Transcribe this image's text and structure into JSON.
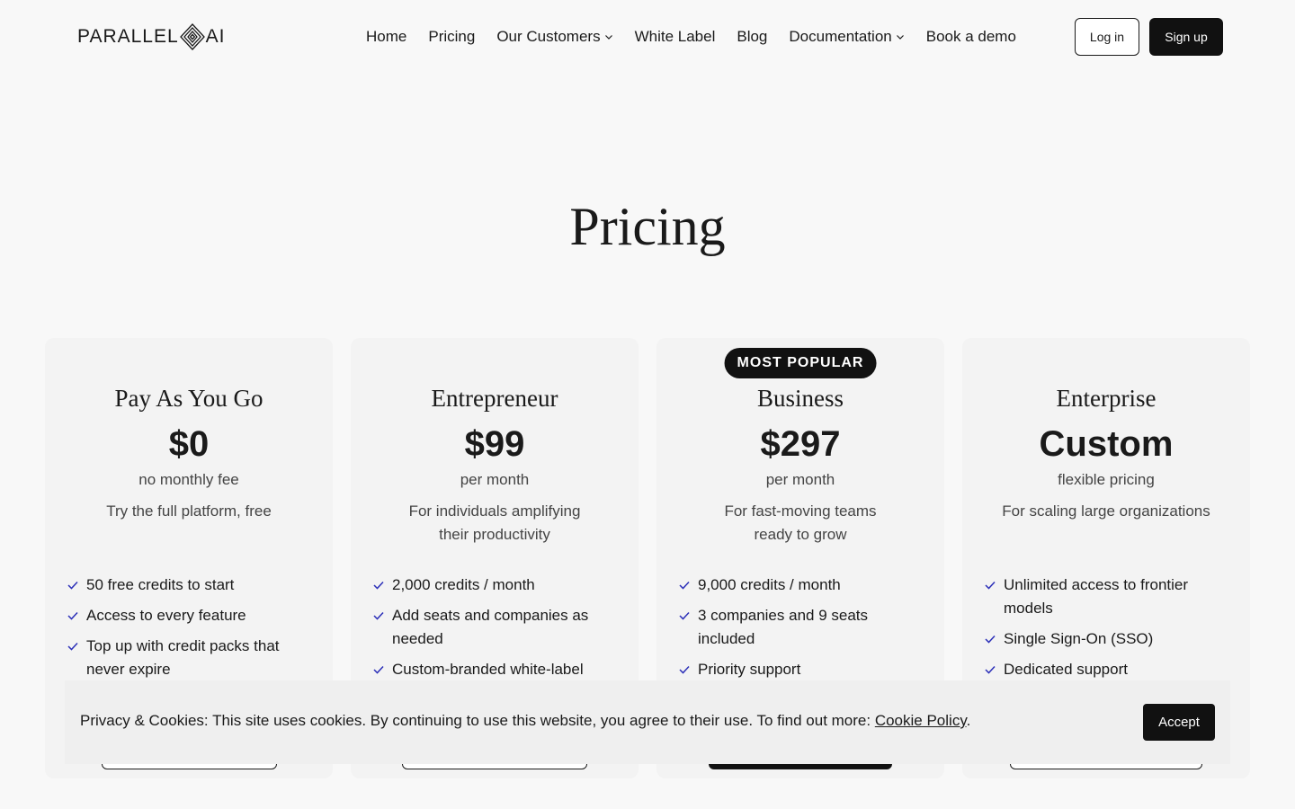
{
  "header": {
    "logo_left": "PARALLEL",
    "logo_right": "AI",
    "nav": [
      {
        "label": "Home",
        "has_dropdown": false
      },
      {
        "label": "Pricing",
        "has_dropdown": false
      },
      {
        "label": "Our Customers",
        "has_dropdown": true
      },
      {
        "label": "White Label",
        "has_dropdown": false
      },
      {
        "label": "Blog",
        "has_dropdown": false
      },
      {
        "label": "Documentation",
        "has_dropdown": true
      },
      {
        "label": "Book a demo",
        "has_dropdown": false
      }
    ],
    "login_label": "Log in",
    "signup_label": "Sign up"
  },
  "title": "Pricing",
  "plans": [
    {
      "name": "Pay As You Go",
      "price": "$0",
      "period": "no monthly fee",
      "description": "Try the full platform, free",
      "features": [
        "50 free credits to start",
        "Access to every feature",
        "Top up with credit packs that never expire"
      ]
    },
    {
      "name": "Entrepreneur",
      "price": "$99",
      "period": "per month",
      "description": "For individuals amplifying their productivity",
      "features": [
        "2,000 credits / month",
        "Add seats and companies as needed",
        "Custom-branded white-label"
      ]
    },
    {
      "name": "Business",
      "badge": "MOST POPULAR",
      "price": "$297",
      "period": "per month",
      "description": "For fast-moving teams ready to grow",
      "features": [
        "9,000 credits / month",
        "3 companies and 9 seats included",
        "Priority support"
      ]
    },
    {
      "name": "Enterprise",
      "price": "Custom",
      "period": "flexible pricing",
      "description": "For scaling large organizations",
      "features": [
        "Unlimited access to frontier models",
        "Single Sign-On (SSO)",
        "Dedicated support"
      ]
    }
  ],
  "cookie": {
    "text": "Privacy & Cookies: This site uses cookies. By continuing to use this website, you agree to their use. To find out more: ",
    "link": "Cookie Policy",
    "after": ".",
    "accept_label": "Accept"
  },
  "icons": {
    "check": "check-icon",
    "chevron": "chevron-down-icon",
    "logo_mark": "diamond-logo-icon"
  },
  "colors": {
    "check": "#2b2fb8",
    "dark": "#111111",
    "background": "#f8f8f8"
  }
}
